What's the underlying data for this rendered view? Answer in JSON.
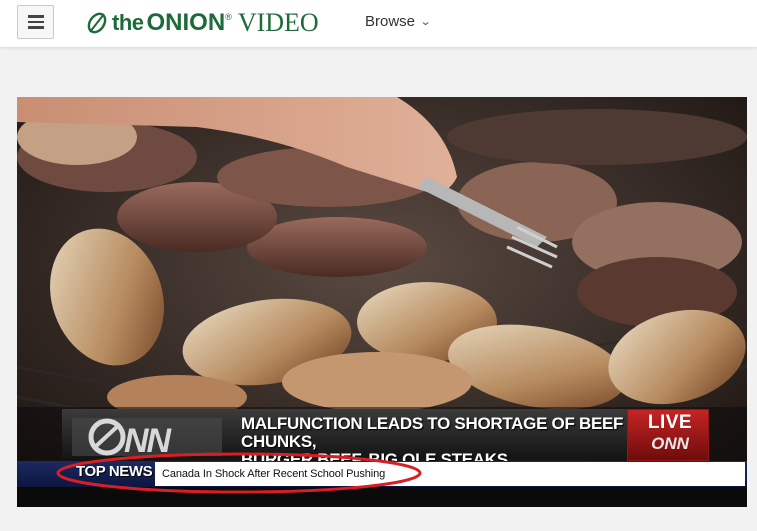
{
  "header": {
    "menu_icon": "hamburger-icon",
    "logo": {
      "the": "the",
      "onion": "ONION",
      "video": "VIDEO",
      "trademark": "®",
      "icon": "onion-leaf-icon",
      "color": "#1e6b3a"
    },
    "browse_label": "Browse",
    "browse_icon": "chevron-down-icon"
  },
  "video": {
    "headline_line1": "MALFUNCTION LEADS TO SHORTAGE OF BEEF CHUNKS,",
    "headline_line2": "BURGER BEEF, BIG OLE STEAKS",
    "live_label": "LIVE",
    "network_label": "ONN",
    "top_news_label": "TOP NEWS",
    "ticker_text": "Canada In Shock After Recent School Pushing",
    "annotation_color": "#d81f26"
  }
}
